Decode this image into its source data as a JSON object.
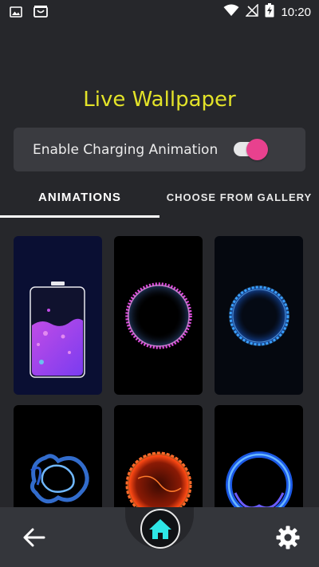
{
  "status_bar": {
    "time": "10:20",
    "icons": [
      "image-icon",
      "shopping-bag-icon",
      "wifi-icon",
      "no-signal-icon",
      "battery-charging-icon"
    ]
  },
  "header": {
    "title": "Live Wallpaper"
  },
  "charging_toggle": {
    "label": "Enable Charging Animation",
    "enabled": true
  },
  "tabs": [
    {
      "label": "ANIMATIONS",
      "selected": true
    },
    {
      "label": "CHOOSE FROM GALLERY",
      "selected": false
    }
  ],
  "animations": [
    {
      "icon": "battery-liquid-thumbnail"
    },
    {
      "icon": "pink-particle-ring-thumbnail"
    },
    {
      "icon": "blue-particle-ring-thumbnail"
    },
    {
      "icon": "blue-smoke-ring-thumbnail"
    },
    {
      "icon": "red-fire-orb-thumbnail"
    },
    {
      "icon": "blue-glow-ring-thumbnail"
    }
  ],
  "bottom_nav": {
    "back_icon": "back-arrow-icon",
    "home_icon": "home-icon",
    "settings_icon": "gear-icon"
  },
  "colors": {
    "title": "#e3e329",
    "accent": "#e8418e",
    "home": "#2ee6e6",
    "background": "#26272b"
  }
}
